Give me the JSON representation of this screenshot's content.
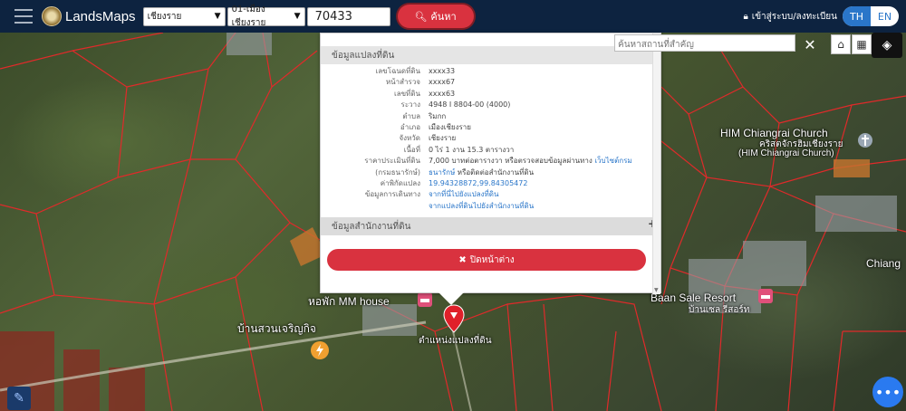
{
  "app": {
    "brand": "LandsMaps"
  },
  "search": {
    "province": "เชียงราย",
    "district": "01-เมืองเชียงราย",
    "parcel_no": "70433",
    "button_label": "ค้นหา"
  },
  "header": {
    "login_label": "เข้าสู่ระบบ/ลงทะเบียน",
    "lang_th": "TH",
    "lang_en": "EN"
  },
  "place_search": {
    "placeholder": "ค้นหาสถานที่สำคัญ"
  },
  "popup": {
    "section1_title": "ข้อมูลแปลงที่ดิน",
    "section2_title": "ข้อมูลสำนักงานที่ดิน",
    "close_label": "ปิดหน้าต่าง",
    "rows": [
      {
        "k": "เลขโฉนดที่ดิน",
        "v": "xxxx33"
      },
      {
        "k": "หน้าสำรวจ",
        "v": "xxxx67"
      },
      {
        "k": "เลขที่ดิน",
        "v": "xxxx63"
      },
      {
        "k": "ระวาง",
        "v": "4948 I 8804-00 (4000)"
      },
      {
        "k": "ตำบล",
        "v": "ริมกก"
      },
      {
        "k": "อำเภอ",
        "v": "เมืองเชียงราย"
      },
      {
        "k": "จังหวัด",
        "v": "เชียงราย"
      },
      {
        "k": "เนื้อที่",
        "v": "0 ไร่ 1 งาน 15.3 ตารางวา"
      },
      {
        "k": "ราคาประเมินที่ดิน",
        "v": "7,000 บาทต่อตารางวา หรือตรวจสอบข้อมูลผ่านทาง",
        "link": "เว็บไซต์กรม"
      },
      {
        "k": "(กรมธนารักษ์)",
        "v": "",
        "link": "ธนารักษ์",
        "v2": " หรือติดต่อสำนักงานที่ดิน"
      },
      {
        "k": "ค่าพิกัดแปลง",
        "v": "",
        "link": "19.94328872,99.84305472"
      },
      {
        "k": "ข้อมูลการเดินทาง",
        "v": "",
        "link": "จากที่นี่ไปยังแปลงที่ดิน"
      },
      {
        "k": "",
        "v": "",
        "link": "จากแปลงที่ดินไปยังสำนักงานที่ดิน"
      }
    ]
  },
  "map_labels": {
    "church": "HIM Chiangrai Church",
    "church_th": "คริสตจักรฮิมเชียงราย",
    "church_sub": "(HIM Chiangrai Church)",
    "mm_house": "หอพัก MM house",
    "garden": "บ้านสวนเจริญกิจ",
    "marker": "ตำแหน่งแปลงที่ดิน",
    "baan_sale": "Baan Sale Resort",
    "baan_sale_th": "บ้านเซล รีสอร์ท",
    "chiang": "Chiang"
  },
  "colors": {
    "header": "#0d2340",
    "accent": "#d9323f",
    "lang": "#2a76c9",
    "parcel_line": "#e02a2a"
  }
}
